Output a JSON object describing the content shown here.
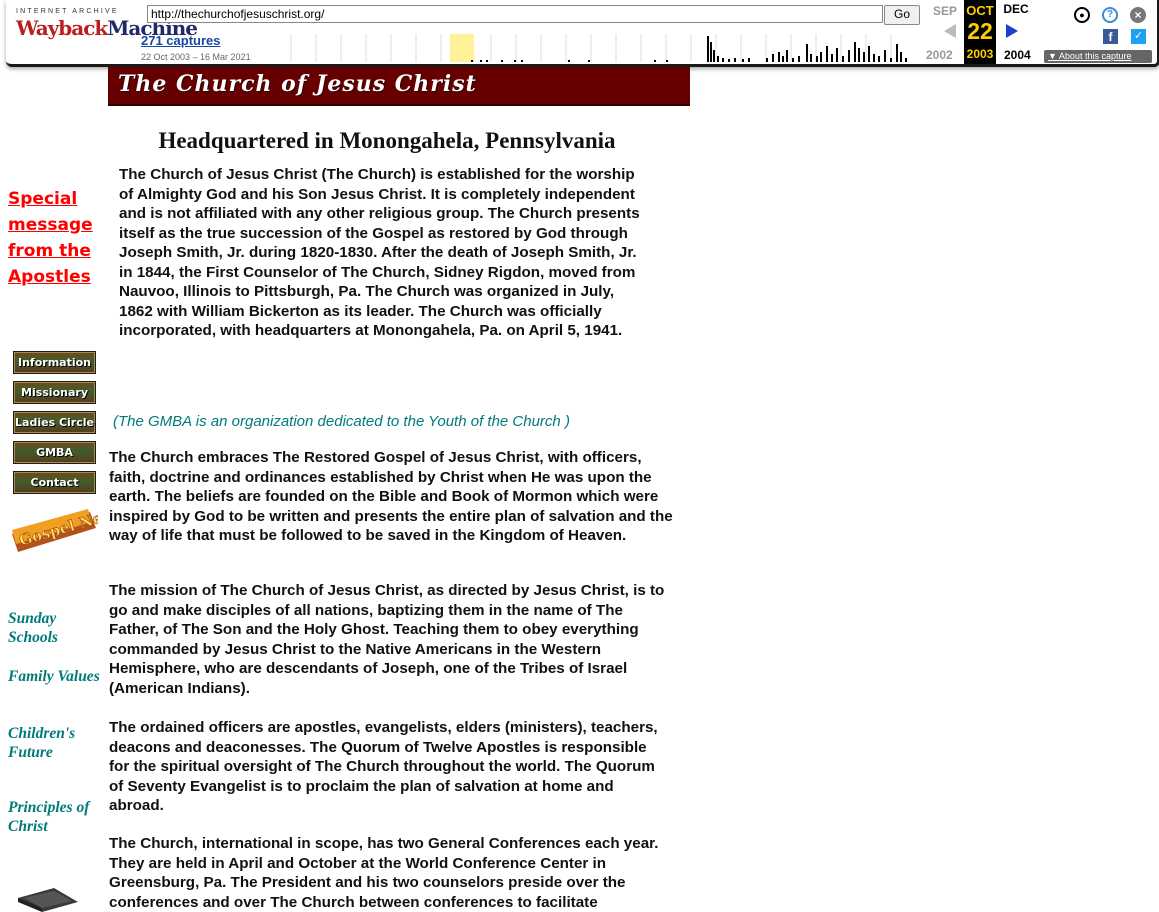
{
  "wayback": {
    "logo_top": "INTERNET ARCHIVE",
    "logo_w1": "Wayback",
    "logo_w2": "Machine",
    "url": "http://thechurchofjesuschrist.org/",
    "go_label": "Go",
    "captures": "271 captures",
    "range": "22 Oct 2003 – 16 Mar 2021",
    "prev_month": "SEP",
    "cur_month": "OCT",
    "cur_day": "22",
    "cur_year": "2003",
    "next_month": "DEC",
    "prev_year": "2002",
    "next_year": "2004",
    "about": "About this capture",
    "icons": [
      "account-icon",
      "help-icon",
      "close-icon",
      "facebook-icon",
      "twitter-icon"
    ]
  },
  "site": {
    "banner_title": "The Church of Jesus Christ",
    "headline": "Headquartered in Monongahela, Pennsylvania",
    "intro": "The Church of Jesus Christ (The Church) is established for the worship of Almighty God and his Son Jesus Christ.  It is completely independent and is not affiliated with any other religious group. The Church presents itself as the true succession of the Gospel as restored by God through Joseph Smith, Jr. during 1820-1830.  After the death of Joseph Smith, Jr. in 1844, the First Counselor of The Church, Sidney Rigdon, moved from Nauvoo, Illinois to Pittsburgh, Pa.  The Church was organized in July, 1862 with William Bickerton as its leader.  The Church was officially incorporated, with headquarters at Monongahela, Pa.  on April 5, 1941.",
    "gmba_note": "(The GMBA is an organization dedicated to the Youth of the Church   )",
    "p1": "The Church embraces The Restored Gospel of Jesus Christ, with officers, faith, doctrine and ordinances established by Christ when He was upon the earth.  The beliefs are founded on the Bible and Book of Mormon which were inspired by God to be written and  presents the entire plan of salvation and the way of life that must be followed to be saved in the Kingdom of Heaven.",
    "p2": "The mission of The Church of Jesus Christ, as directed by Jesus Christ, is to go and make disciples of all nations, baptizing them in the name of The Father, of The Son and the Holy Ghost.  Teaching them to obey everything commanded by Jesus Christ to the Native Americans in the Western Hemisphere, who are descendants of Joseph, one of the Tribes of Israel (American Indians).",
    "p3": "The ordained officers are apostles, evangelists, elders (ministers), teachers, deacons and deaconesses.  The Quorum of Twelve Apostles is responsible for the spiritual oversight of The Church throughout the world.  The Quorum of Seventy Evangelist is to proclaim the plan of salvation at home and abroad.",
    "p4": "The Church, international in scope, has two General Conferences each year.  They are held in April and October at the World Conference Center in Greensburg, Pa.    The President and his two counselors preside over the conferences and over The Church between conferences to facilitate"
  },
  "sidebar": {
    "special": "Special message from the Apostles",
    "nav": [
      "Information",
      "Missionary",
      "Ladies Circle",
      "GMBA",
      "Contact"
    ],
    "gospel_news": "Gospel News",
    "links": [
      "Sunday Schools",
      "Family Values",
      "Children's Future",
      "Principles of Christ"
    ]
  },
  "colors": {
    "banner_bg": "#660000",
    "special_link": "#ff0000",
    "teal_links": "#007a7a",
    "wayback_accent": "#ffcc00"
  }
}
